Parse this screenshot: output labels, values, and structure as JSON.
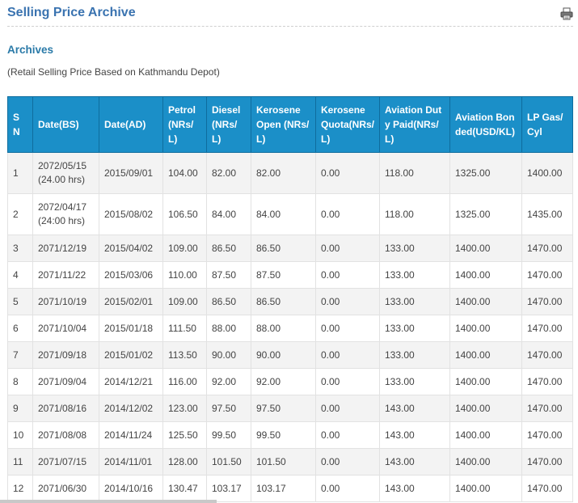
{
  "page": {
    "title": "Selling Price Archive",
    "section_title": "Archives",
    "subtitle": "(Retail Selling Price Based on Kathmandu Depot)",
    "print_icon": "printer-icon"
  },
  "colors": {
    "title": "#3a73b0",
    "header_bg": "#1b8fc8",
    "row_alt": "#f3f3f3"
  },
  "table": {
    "headers": [
      "S N",
      "Date(BS)",
      "Date(AD)",
      "Petrol(NRs/L)",
      "Diesel(NRs/L)",
      "Kerosene Open (NRs/L)",
      "Kerosene Quota(NRs/L)",
      "Aviation Duty Paid(NRs/L)",
      "Aviation Bonded(USD/KL)",
      "LP Gas/Cyl"
    ],
    "rows": [
      [
        "1",
        "2072/05/15",
        "(24.00 hrs)",
        "2015/09/01",
        "104.00",
        "82.00",
        "82.00",
        "0.00",
        "118.00",
        "1325.00",
        "1400.00"
      ],
      [
        "2",
        "2072/04/17",
        "(24:00 hrs)",
        "2015/08/02",
        "106.50",
        "84.00",
        "84.00",
        "0.00",
        "118.00",
        "1325.00",
        "1435.00"
      ],
      [
        "3",
        "2071/12/19",
        "",
        "2015/04/02",
        "109.00",
        "86.50",
        "86.50",
        "0.00",
        "133.00",
        "1400.00",
        "1470.00"
      ],
      [
        "4",
        "2071/11/22",
        "",
        "2015/03/06",
        "110.00",
        "87.50",
        "87.50",
        "0.00",
        "133.00",
        "1400.00",
        "1470.00"
      ],
      [
        "5",
        "2071/10/19",
        "",
        "2015/02/01",
        "109.00",
        "86.50",
        "86.50",
        "0.00",
        "133.00",
        "1400.00",
        "1470.00"
      ],
      [
        "6",
        "2071/10/04",
        "",
        "2015/01/18",
        "111.50",
        "88.00",
        "88.00",
        "0.00",
        "133.00",
        "1400.00",
        "1470.00"
      ],
      [
        "7",
        "2071/09/18",
        "",
        "2015/01/02",
        "113.50",
        "90.00",
        "90.00",
        "0.00",
        "133.00",
        "1400.00",
        "1470.00"
      ],
      [
        "8",
        "2071/09/04",
        "",
        "2014/12/21",
        "116.00",
        "92.00",
        "92.00",
        "0.00",
        "133.00",
        "1400.00",
        "1470.00"
      ],
      [
        "9",
        "2071/08/16",
        "",
        "2014/12/02",
        "123.00",
        "97.50",
        "97.50",
        "0.00",
        "143.00",
        "1400.00",
        "1470.00"
      ],
      [
        "10",
        "2071/08/08",
        "",
        "2014/11/24",
        "125.50",
        "99.50",
        "99.50",
        "0.00",
        "143.00",
        "1400.00",
        "1470.00"
      ],
      [
        "11",
        "2071/07/15",
        "",
        "2014/11/01",
        "128.00",
        "101.50",
        "101.50",
        "0.00",
        "143.00",
        "1400.00",
        "1470.00"
      ],
      [
        "12",
        "2071/06/30",
        "",
        "2014/10/16",
        "130.47",
        "103.17",
        "103.17",
        "0.00",
        "143.00",
        "1400.00",
        "1470.00"
      ]
    ]
  }
}
